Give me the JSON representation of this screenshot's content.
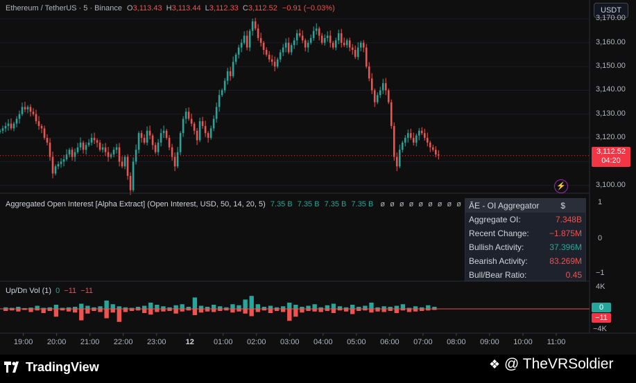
{
  "header": {
    "symbol": "Ethereum / TetherUS · 5 · Binance",
    "o_label": "O",
    "o_value": "3,113.43",
    "h_label": "H",
    "h_value": "3,113.44",
    "l_label": "L",
    "l_value": "3,112.33",
    "c_label": "C",
    "c_value": "3,112.52",
    "change": "−0.91 (−0.03%)"
  },
  "currency_button": "USDT",
  "price_tag": {
    "price": "3,112.52",
    "countdown": "04:20"
  },
  "oi_indicator": {
    "label": "Aggregated Open Interest [Alpha Extract] (Open Interest, USD, 50, 14, 20, 5)",
    "values": [
      "7.35 B",
      "7.35 B",
      "7.35 B",
      "7.35 B"
    ],
    "empty_markers": [
      "ø",
      "ø",
      "ø",
      "ø",
      "ø",
      "ø",
      "ø",
      "ø",
      "ø",
      "ø",
      "ø",
      "ø",
      "ø",
      "ø"
    ],
    "axis": [
      "1",
      "0",
      "−1"
    ],
    "table": {
      "title": "ĀE - OI Aggregator",
      "title_right": "$",
      "rows": [
        {
          "label": "Aggregate OI:",
          "value": "7.348B",
          "color": "#ef5350"
        },
        {
          "label": "Recent Change:",
          "value": "−1.875M",
          "color": "#ef5350"
        },
        {
          "label": "Bullish Activity:",
          "value": "37.396M",
          "color": "#26a69a"
        },
        {
          "label": "Bearish Activity:",
          "value": "83.269M",
          "color": "#ef5350"
        },
        {
          "label": "Bull/Bear Ratio:",
          "value": "0.45",
          "color": "#ef5350"
        }
      ]
    }
  },
  "volume_indicator": {
    "label": "Up/Dn Vol (1)",
    "v1": "0",
    "v2": "−11",
    "v3": "−11",
    "axis_top": "4K",
    "axis_bottom": "−4K",
    "tag_up": "0",
    "tag_dn": "−11"
  },
  "colors": {
    "up": "#26a69a",
    "down": "#ef5350",
    "background": "#0f0f0f"
  },
  "chart_data": {
    "type": "candlestick",
    "symbol": "ETHUSDT",
    "interval": "5",
    "y_ticks": [
      3100,
      3110,
      3120,
      3130,
      3140,
      3150,
      3160,
      3170
    ],
    "y_tick_labels": [
      "3,100.00",
      "3,110.00",
      "3,120.00",
      "3,130.00",
      "3,140.00",
      "3,150.00",
      "3,160.00",
      "3,170.00"
    ],
    "ylim": [
      3097,
      3171
    ],
    "x_tick_labels": [
      "19:00",
      "20:00",
      "21:00",
      "22:00",
      "23:00",
      "12",
      "01:00",
      "02:00",
      "03:00",
      "04:00",
      "05:00",
      "06:00",
      "07:00",
      "08:00",
      "09:00",
      "10:00",
      "11:00"
    ],
    "x_tick_times": [
      19,
      20,
      21,
      22,
      23,
      24,
      25,
      26,
      27,
      28,
      29,
      30,
      31,
      32,
      33,
      34,
      35
    ],
    "xlim": [
      18.3,
      36.0
    ],
    "last_price": 3112.52,
    "start_time": 18.3,
    "bar_interval_hours": 0.08333,
    "closes": [
      3123,
      3124,
      3125,
      3126,
      3124,
      3126,
      3128,
      3130,
      3133,
      3132,
      3133,
      3131,
      3130,
      3127,
      3125,
      3124,
      3120,
      3118,
      3112,
      3105,
      3108,
      3109,
      3110,
      3111,
      3113,
      3115,
      3112,
      3114,
      3116,
      3118,
      3115,
      3117,
      3118,
      3120,
      3119,
      3118,
      3115,
      3116,
      3114,
      3112,
      3113,
      3115,
      3116,
      3110,
      3108,
      3112,
      3104,
      3098,
      3110,
      3115,
      3122,
      3120,
      3118,
      3123,
      3121,
      3117,
      3114,
      3118,
      3122,
      3123,
      3120,
      3116,
      3112,
      3108,
      3114,
      3122,
      3128,
      3131,
      3128,
      3126,
      3123,
      3119,
      3127,
      3125,
      3122,
      3120,
      3124,
      3128,
      3133,
      3138,
      3140,
      3144,
      3148,
      3146,
      3152,
      3155,
      3158,
      3160,
      3163,
      3158,
      3165,
      3169,
      3166,
      3162,
      3160,
      3157,
      3155,
      3153,
      3152,
      3150,
      3153,
      3156,
      3158,
      3160,
      3156,
      3159,
      3161,
      3164,
      3163,
      3161,
      3158,
      3160,
      3162,
      3165,
      3166,
      3163,
      3160,
      3162,
      3163,
      3160,
      3158,
      3161,
      3164,
      3160,
      3159,
      3161,
      3158,
      3157,
      3154,
      3158,
      3160,
      3158,
      3150,
      3145,
      3140,
      3135,
      3138,
      3140,
      3143,
      3140,
      3135,
      3125,
      3112,
      3108,
      3115,
      3118,
      3120,
      3122,
      3120,
      3118,
      3121,
      3123,
      3122,
      3120,
      3118,
      3116,
      3115,
      3113,
      3112.52
    ],
    "up_volumes": [
      300,
      200,
      400,
      150,
      250,
      600,
      200,
      300,
      800,
      200,
      300,
      400,
      1000,
      600,
      300,
      500,
      1600,
      900,
      500,
      300,
      200,
      400,
      600,
      1200,
      800,
      500,
      300,
      700,
      900,
      400,
      2200,
      600,
      400,
      800,
      500,
      300,
      900,
      700,
      1800,
      2500,
      900,
      400,
      600,
      300,
      500,
      1200,
      800,
      400,
      600,
      900,
      300,
      700,
      1000,
      500,
      300,
      800,
      400,
      600,
      1200,
      300,
      500,
      400,
      600,
      900,
      200,
      500,
      300,
      700,
      400
    ],
    "down_volumes": [
      400,
      300,
      500,
      200,
      600,
      300,
      800,
      400,
      1500,
      300,
      500,
      700,
      2200,
      900,
      400,
      600,
      1800,
      700,
      2500,
      600,
      400,
      300,
      800,
      1100,
      600,
      500,
      400,
      900,
      500,
      300,
      1200,
      700,
      500,
      600,
      400,
      300,
      700,
      500,
      900,
      1400,
      600,
      300,
      800,
      400,
      600,
      2300,
      1500,
      700,
      400,
      500,
      600,
      400,
      800,
      300,
      500,
      1000,
      400,
      300,
      700,
      500,
      600,
      400,
      800,
      300,
      600,
      500,
      400,
      300,
      200
    ]
  }
}
